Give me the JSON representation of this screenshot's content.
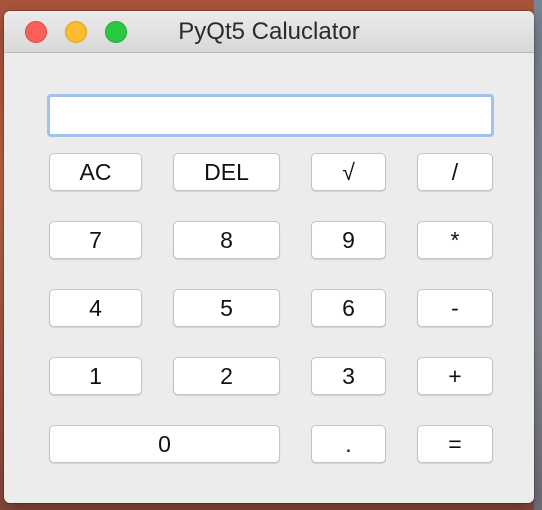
{
  "window": {
    "title": "PyQt5 Caluclator"
  },
  "display": {
    "value": ""
  },
  "buttons": {
    "ac": "AC",
    "del": "DEL",
    "sqrt": "√",
    "divide": "/",
    "seven": "7",
    "eight": "8",
    "nine": "9",
    "multiply": "*",
    "four": "4",
    "five": "5",
    "six": "6",
    "subtract": "-",
    "one": "1",
    "two": "2",
    "three": "3",
    "add": "+",
    "zero": "0",
    "decimal": ".",
    "equals": "="
  },
  "colors": {
    "close": "#fc5f57",
    "minimize": "#fdbc2e",
    "zoom": "#2ac840",
    "display_focus_ring": "#9fc3ea",
    "window_background": "#ececec"
  }
}
